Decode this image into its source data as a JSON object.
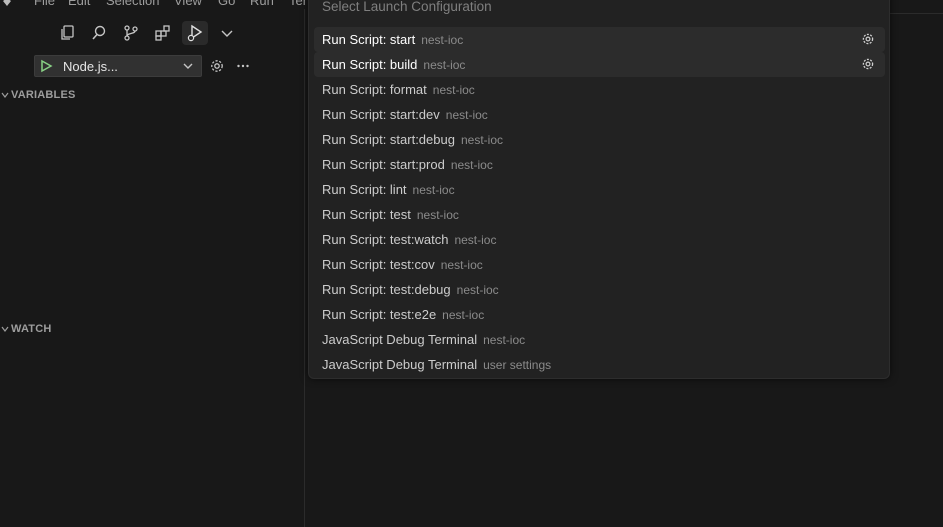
{
  "menubar": {
    "items": [
      "File",
      "Edit",
      "Selection",
      "View",
      "Go",
      "Run",
      "Ter"
    ]
  },
  "sidebar": {
    "activity_icons": [
      "explorer-icon",
      "search-icon",
      "source-control-icon",
      "extensions-icon",
      "run-debug-icon",
      "chevron-down-icon"
    ],
    "launch_config": "Node.js...",
    "sections": {
      "variables": "VARIABLES",
      "watch": "WATCH"
    }
  },
  "quickpick": {
    "placeholder": "Select Launch Configuration",
    "items": [
      {
        "label": "Run Script: start",
        "desc": "nest-ioc"
      },
      {
        "label": "Run Script: build",
        "desc": "nest-ioc"
      },
      {
        "label": "Run Script: format",
        "desc": "nest-ioc"
      },
      {
        "label": "Run Script: start:dev",
        "desc": "nest-ioc"
      },
      {
        "label": "Run Script: start:debug",
        "desc": "nest-ioc"
      },
      {
        "label": "Run Script: start:prod",
        "desc": "nest-ioc"
      },
      {
        "label": "Run Script: lint",
        "desc": "nest-ioc"
      },
      {
        "label": "Run Script: test",
        "desc": "nest-ioc"
      },
      {
        "label": "Run Script: test:watch",
        "desc": "nest-ioc"
      },
      {
        "label": "Run Script: test:cov",
        "desc": "nest-ioc"
      },
      {
        "label": "Run Script: test:debug",
        "desc": "nest-ioc"
      },
      {
        "label": "Run Script: test:e2e",
        "desc": "nest-ioc"
      },
      {
        "label": "JavaScript Debug Terminal",
        "desc": "nest-ioc"
      },
      {
        "label": "JavaScript Debug Terminal",
        "desc": "user settings"
      }
    ]
  },
  "colors": {
    "background": "#181818",
    "quickpick_bg": "#222222",
    "highlight": "#2c2c2c",
    "play_green": "#89d185"
  }
}
